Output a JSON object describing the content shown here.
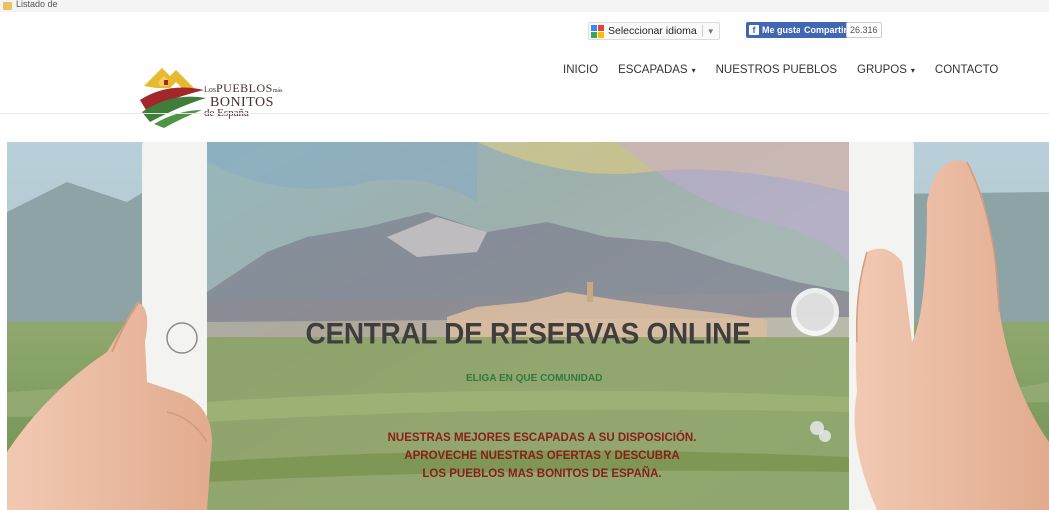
{
  "browser": {
    "tab_text": "Listado de"
  },
  "header": {
    "language_widget": {
      "label": "Seleccionar idioma",
      "arrow": "▼"
    },
    "social": {
      "like_label": "Me gusta",
      "share_label": "Compartir",
      "count": "26.316"
    },
    "nav": [
      {
        "label": "INICIO",
        "has_caret": false
      },
      {
        "label": "ESCAPADAS",
        "has_caret": true
      },
      {
        "label": "NUESTROS PUEBLOS",
        "has_caret": false
      },
      {
        "label": "GRUPOS",
        "has_caret": true
      },
      {
        "label": "CONTACTO",
        "has_caret": false
      }
    ],
    "caret": "▾",
    "logo": {
      "line1_small": "Los",
      "line1_big": "PUEBLOS",
      "line1_suffix": "más",
      "line2": "BONITOS",
      "line3": "de España",
      "colors": {
        "roof": "#e8b92e",
        "green": "#3f7d3a",
        "red": "#a3262a"
      }
    }
  },
  "hero": {
    "title": "CENTRAL DE RESERVAS ONLINE",
    "subtitle": "ELIGA EN QUE COMUNIDAD",
    "promo_lines": [
      "NUESTRAS MEJORES ESCAPADAS A SU DISPOSICIÓN.",
      "APROVECHE NUESTRAS OFERTAS Y DESCUBRA",
      "LOS PUEBLOS MAS BONITOS DE ESPAÑA."
    ]
  }
}
